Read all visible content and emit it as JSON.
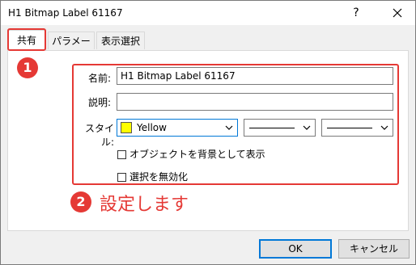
{
  "window": {
    "title": "H1 Bitmap Label 61167",
    "help_label": "?"
  },
  "tabs": [
    {
      "label": "共有",
      "active": true
    },
    {
      "label": "パラメータ",
      "active": false
    },
    {
      "label": "表示選択",
      "active": false
    }
  ],
  "form": {
    "name_label": "名前:",
    "name_value": "H1 Bitmap Label 61167",
    "description_label": "説明:",
    "description_value": "",
    "style_label": "スタイル:",
    "color_value": "Yellow",
    "color_hex": "#ffff00",
    "checkbox_background_label": "オブジェクトを背景として表示",
    "checkbox_background_checked": false,
    "checkbox_disable_selection_label": "選択を無効化",
    "checkbox_disable_selection_checked": false
  },
  "buttons": {
    "ok_label": "OK",
    "cancel_label": "キャンセル"
  },
  "annotations": {
    "step1_number": "1",
    "step2_number": "2",
    "step2_text": "設定します",
    "highlight_color": "#e53935"
  },
  "icons": {
    "close": "close-icon",
    "chevron": "chevron-down-icon",
    "swatch": "color-swatch-icon"
  }
}
